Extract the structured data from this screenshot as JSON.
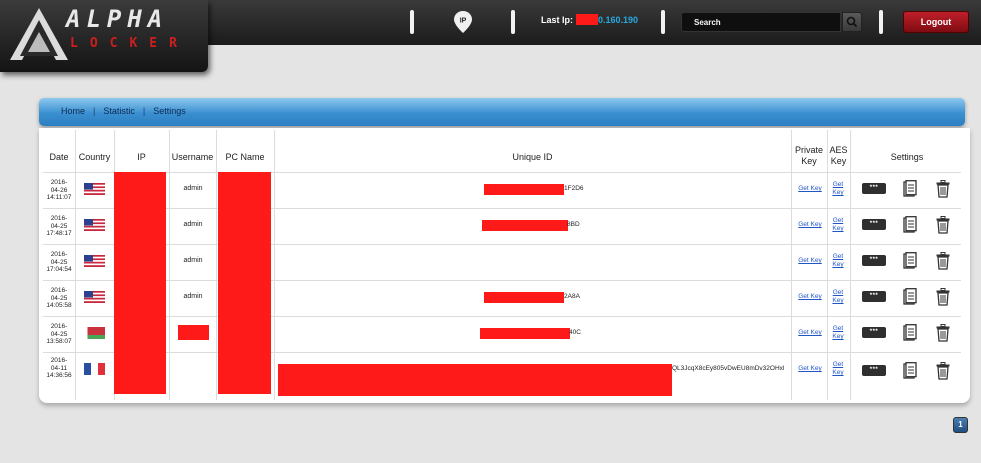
{
  "header": {
    "logo_top": "ALPHA",
    "logo_bottom": "LOCKER",
    "last_ip_label": "Last Ip:",
    "last_ip_value": "0.160.190",
    "search_placeholder": "Search",
    "logout_label": "Logout"
  },
  "nav": {
    "items": [
      "Home",
      "Statistic",
      "Settings"
    ],
    "divider": "|"
  },
  "table": {
    "headers": {
      "date": "Date",
      "country": "Country",
      "ip": "IP",
      "username": "Username",
      "pcname": "PC Name",
      "uid": "Unique ID",
      "private_key": "Private Key",
      "aes_key": "AES Key",
      "settings": "Settings"
    },
    "rows": [
      {
        "date": [
          "2016-",
          "04-26",
          "14:11:07"
        ],
        "username": "admin",
        "uid_tail": "1F2D6",
        "flag": "us"
      },
      {
        "date": [
          "2016-",
          "04-25",
          "17:48:17"
        ],
        "username": "admin",
        "uid_tail": "8BD",
        "flag": "us"
      },
      {
        "date": [
          "2016-",
          "04-25",
          "17:04:54"
        ],
        "username": "admin",
        "uid_tail": "",
        "flag": "us"
      },
      {
        "date": [
          "2016-",
          "04-25",
          "14:05:58"
        ],
        "username": "admin",
        "uid_tail": "2A8A",
        "flag": "us"
      },
      {
        "date": [
          "2016-",
          "04-25",
          "13:58:07"
        ],
        "username": "",
        "uid_tail": "40C",
        "flag": "by"
      },
      {
        "date": [
          "2016-",
          "04-11",
          "14:36:56"
        ],
        "username": "",
        "uid_tail": "QL3JcqX8cEy805vDwEU8mDv32OHxl",
        "flag": "fr"
      }
    ],
    "private_key_link": "Get Key",
    "aes_key_link_top": "Get",
    "aes_key_link_bottom": "Key",
    "key_icon_text": "***"
  },
  "pagination": {
    "current": "1"
  },
  "colors": {
    "accent_blue": "#2b7fc2",
    "redaction": "#ff1a1a",
    "logout": "#a0141c",
    "ip_text": "#29a8e0"
  },
  "icons": [
    "ip-pin-icon",
    "search-icon",
    "key-icon",
    "document-icon",
    "trash-icon"
  ]
}
